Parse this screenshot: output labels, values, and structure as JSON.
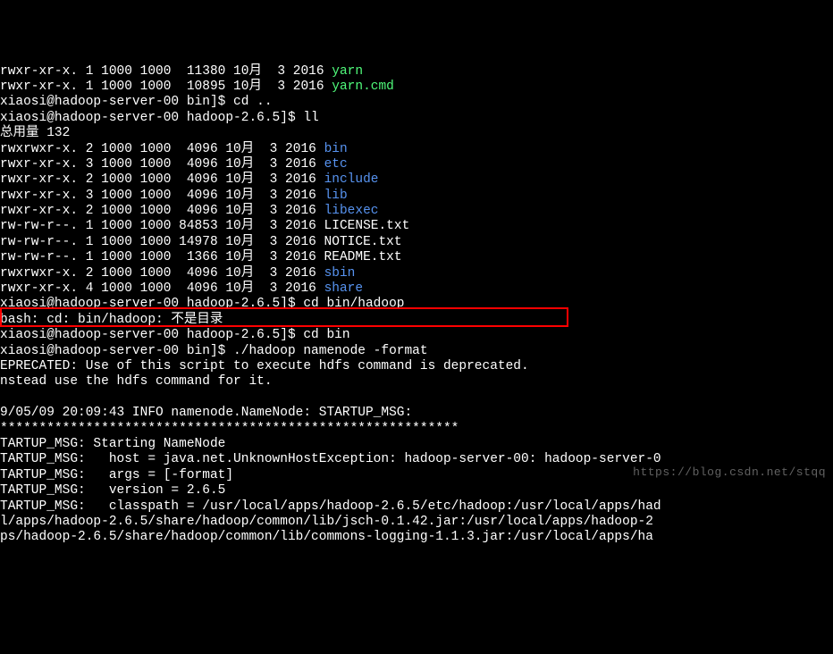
{
  "lines": [
    {
      "segments": [
        {
          "t": "rwxr-xr-x. 1 1000 1000  11380 10月  3 2016 "
        },
        {
          "t": "yarn",
          "cls": "green"
        }
      ]
    },
    {
      "segments": [
        {
          "t": "rwxr-xr-x. 1 1000 1000  10895 10月  3 2016 "
        },
        {
          "t": "yarn.cmd",
          "cls": "green"
        }
      ]
    },
    {
      "segments": [
        {
          "t": "xiaosi@hadoop-server-00 bin]$ cd .."
        }
      ]
    },
    {
      "segments": [
        {
          "t": "xiaosi@hadoop-server-00 hadoop-2.6.5]$ ll"
        }
      ]
    },
    {
      "segments": [
        {
          "t": "总用量 132"
        }
      ]
    },
    {
      "segments": [
        {
          "t": "rwxrwxr-x. 2 1000 1000  4096 10月  3 2016 "
        },
        {
          "t": "bin",
          "cls": "blue"
        }
      ]
    },
    {
      "segments": [
        {
          "t": "rwxr-xr-x. 3 1000 1000  4096 10月  3 2016 "
        },
        {
          "t": "etc",
          "cls": "blue"
        }
      ]
    },
    {
      "segments": [
        {
          "t": "rwxr-xr-x. 2 1000 1000  4096 10月  3 2016 "
        },
        {
          "t": "include",
          "cls": "blue"
        }
      ]
    },
    {
      "segments": [
        {
          "t": "rwxr-xr-x. 3 1000 1000  4096 10月  3 2016 "
        },
        {
          "t": "lib",
          "cls": "blue"
        }
      ]
    },
    {
      "segments": [
        {
          "t": "rwxr-xr-x. 2 1000 1000  4096 10月  3 2016 "
        },
        {
          "t": "libexec",
          "cls": "blue"
        }
      ]
    },
    {
      "segments": [
        {
          "t": "rw-rw-r--. 1 1000 1000 84853 10月  3 2016 LICENSE.txt"
        }
      ]
    },
    {
      "segments": [
        {
          "t": "rw-rw-r--. 1 1000 1000 14978 10月  3 2016 NOTICE.txt"
        }
      ]
    },
    {
      "segments": [
        {
          "t": "rw-rw-r--. 1 1000 1000  1366 10月  3 2016 README.txt"
        }
      ]
    },
    {
      "segments": [
        {
          "t": "rwxrwxr-x. 2 1000 1000  4096 10月  3 2016 "
        },
        {
          "t": "sbin",
          "cls": "blue"
        }
      ]
    },
    {
      "segments": [
        {
          "t": "rwxr-xr-x. 4 1000 1000  4096 10月  3 2016 "
        },
        {
          "t": "share",
          "cls": "blue"
        }
      ]
    },
    {
      "segments": [
        {
          "t": "xiaosi@hadoop-server-00 hadoop-2.6.5]$ cd bin/hadoop"
        }
      ]
    },
    {
      "segments": [
        {
          "t": "bash: cd: bin/hadoop: 不是目录"
        }
      ]
    },
    {
      "segments": [
        {
          "t": "xiaosi@hadoop-server-00 hadoop-2.6.5]$ cd bin"
        }
      ]
    },
    {
      "segments": [
        {
          "t": "xiaosi@hadoop-server-00 bin]$ ./hadoop namenode -format"
        }
      ]
    },
    {
      "segments": [
        {
          "t": "EPRECATED: Use of this script to execute hdfs command is deprecated."
        }
      ]
    },
    {
      "segments": [
        {
          "t": "nstead use the hdfs command for it."
        }
      ]
    },
    {
      "segments": [
        {
          "t": ""
        }
      ]
    },
    {
      "segments": [
        {
          "t": "9/05/09 20:09:43 INFO namenode.NameNode: STARTUP_MSG:"
        }
      ]
    },
    {
      "segments": [
        {
          "t": "***********************************************************"
        }
      ]
    },
    {
      "segments": [
        {
          "t": "TARTUP_MSG: Starting NameNode"
        }
      ]
    },
    {
      "segments": [
        {
          "t": "TARTUP_MSG:   host = java.net.UnknownHostException: hadoop-server-00: hadoop-server-0"
        }
      ]
    },
    {
      "segments": [
        {
          "t": "TARTUP_MSG:   args = [-format]"
        }
      ]
    },
    {
      "segments": [
        {
          "t": "TARTUP_MSG:   version = 2.6.5"
        }
      ]
    },
    {
      "segments": [
        {
          "t": "TARTUP_MSG:   classpath = /usr/local/apps/hadoop-2.6.5/etc/hadoop:/usr/local/apps/had"
        }
      ]
    },
    {
      "segments": [
        {
          "t": "l/apps/hadoop-2.6.5/share/hadoop/common/lib/jsch-0.1.42.jar:/usr/local/apps/hadoop-2"
        }
      ]
    },
    {
      "segments": [
        {
          "t": "ps/hadoop-2.6.5/share/hadoop/common/lib/commons-logging-1.1.3.jar:/usr/local/apps/ha"
        }
      ]
    }
  ],
  "highlight_command": "xiaosi@hadoop-server-00 bin]$ ./hadoop namenode -format",
  "watermark": "https://blog.csdn.net/stqq"
}
